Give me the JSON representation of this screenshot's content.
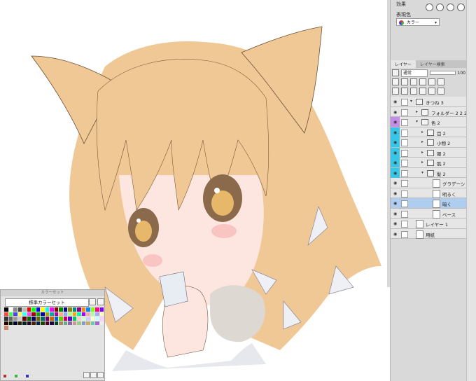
{
  "panel": {
    "effect_label": "効果",
    "display_color_label": "表現色",
    "display_color_value": "カラー",
    "tabs": [
      "レイヤー",
      "レイヤー検索"
    ],
    "blend_mode": "通常",
    "opacity": "100"
  },
  "layers": [
    {
      "name": "きつね 3",
      "type": "folder",
      "indent": 0,
      "mark": ""
    },
    {
      "name": "フォルダー 2 2 2",
      "type": "folder",
      "indent": 1,
      "mark": ""
    },
    {
      "name": "色 2",
      "type": "folder",
      "indent": 1,
      "mark": "purple"
    },
    {
      "name": "目 2",
      "type": "folder",
      "indent": 2,
      "mark": "cyan"
    },
    {
      "name": "小物 2",
      "type": "folder",
      "indent": 2,
      "mark": "cyan"
    },
    {
      "name": "服 2",
      "type": "folder",
      "indent": 2,
      "mark": "cyan"
    },
    {
      "name": "肌 2",
      "type": "folder",
      "indent": 2,
      "mark": "cyan"
    },
    {
      "name": "髪 2",
      "type": "folder",
      "indent": 2,
      "mark": "cyan"
    },
    {
      "name": "グラデーシ",
      "type": "layer",
      "indent": 3,
      "mark": ""
    },
    {
      "name": "明るく",
      "type": "layer",
      "indent": 3,
      "mark": ""
    },
    {
      "name": "暗く",
      "type": "layer",
      "indent": 3,
      "mark": "",
      "selected": true
    },
    {
      "name": "ベース",
      "type": "layer",
      "indent": 3,
      "mark": ""
    },
    {
      "name": "レイヤー 1",
      "type": "layer",
      "indent": 0,
      "mark": ""
    },
    {
      "name": "用紙",
      "type": "layer",
      "indent": 0,
      "mark": ""
    }
  ],
  "color_set": {
    "title": "カラーセット",
    "set_name": "標準カラーセット"
  },
  "colors": {
    "hair": "#f0c896",
    "skin": "#fde6e0",
    "accent_purple": "#c58ce8",
    "accent_cyan": "#38c6e6",
    "selection": "#aecdef"
  },
  "icons": [
    "eye-icon",
    "folder-icon",
    "lock-icon",
    "add-color-icon",
    "delete-icon",
    "settings-icon"
  ]
}
